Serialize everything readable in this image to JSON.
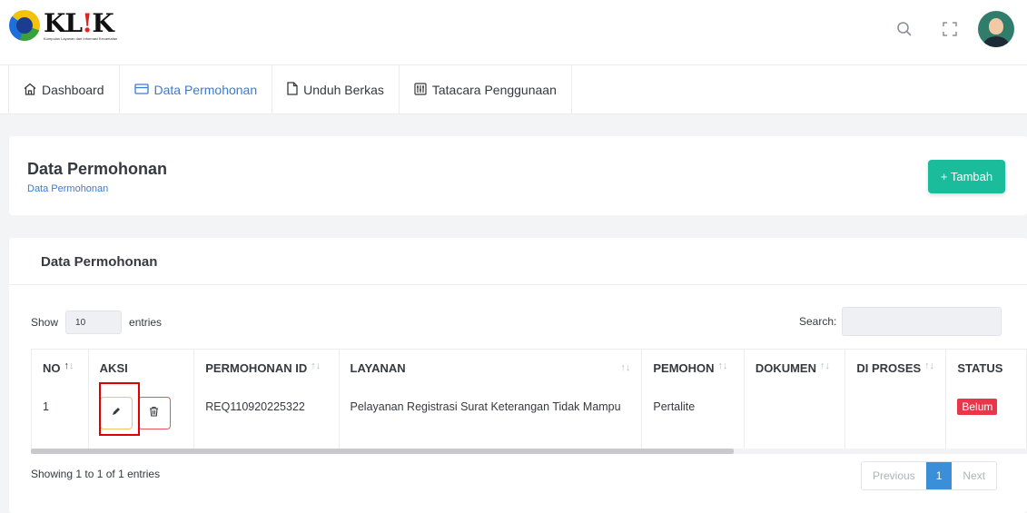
{
  "header": {
    "logo_word": "KL",
    "logo_bang": "!",
    "logo_word_end": "K",
    "logo_subtitle": "Kumpulan Layanan dan Informasi Kecamatan",
    "search_icon": "search-icon",
    "fullscreen_icon": "fullscreen-icon",
    "avatar": "user-avatar"
  },
  "nav": {
    "items": [
      {
        "label": "Dashboard",
        "icon": "home-icon"
      },
      {
        "label": "Data Permohonan",
        "icon": "card-icon"
      },
      {
        "label": "Unduh Berkas",
        "icon": "file-icon"
      },
      {
        "label": "Tatacara Penggunaan",
        "icon": "guide-icon"
      }
    ]
  },
  "page": {
    "title": "Data Permohonan",
    "breadcrumb": "Data Permohonan",
    "add_button": "+ Tambah"
  },
  "card": {
    "title": "Data Permohonan",
    "show_label": "Show",
    "entries_value": "10",
    "entries_label": "entries",
    "search_label": "Search:",
    "search_value": ""
  },
  "table": {
    "columns": [
      "NO",
      "AKSI",
      "PERMOHONAN ID",
      "LAYANAN",
      "PEMOHON",
      "DOKUMEN",
      "DI PROSES",
      "STATUS"
    ],
    "rows": [
      {
        "no": "1",
        "permohonan_id": "REQ110920225322",
        "layanan": "Pelayanan Registrasi Surat Keterangan Tidak Mampu",
        "pemohon": "Pertalite",
        "dokumen": "",
        "di_proses": "",
        "status": "Belum"
      }
    ]
  },
  "footer": {
    "info": "Showing 1 to 1 of 1 entries",
    "prev": "Previous",
    "page": "1",
    "next": "Next"
  },
  "colors": {
    "accent": "#3a7bd5",
    "add_button": "#1abc9c",
    "status_badge": "#e8374a",
    "highlight": "#e00000"
  }
}
